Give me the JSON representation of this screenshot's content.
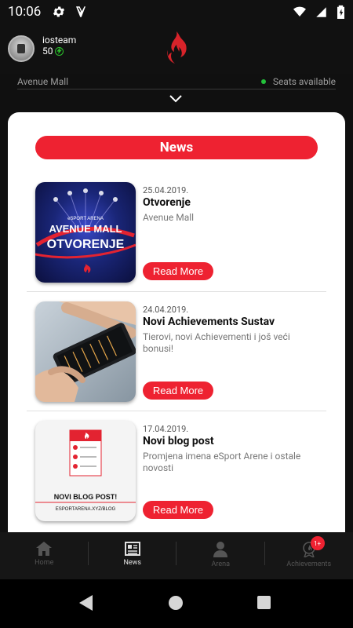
{
  "status": {
    "time": "10:06"
  },
  "user": {
    "name": "iosteam",
    "points": "50"
  },
  "location": {
    "name": "Avenue Mall",
    "seats_text": "Seats available"
  },
  "section_title": "News",
  "news": [
    {
      "date": "25.04.2019.",
      "title": "Otvorenje",
      "desc": "Avenue Mall",
      "button": "Read More",
      "thumb": {
        "top_text": "AVENUE MALL",
        "main_text": "OTVORENJE",
        "small_text": "eSPORT ARENA"
      }
    },
    {
      "date": "24.04.2019.",
      "title": "Novi Achievements Sustav",
      "desc": "Tierovi, novi Achievementi i još veći bonusi!",
      "button": "Read More"
    },
    {
      "date": "17.04.2019.",
      "title": "Novi blog post",
      "desc": "Promjena imena eSport Arene i ostale novosti",
      "button": "Read More",
      "thumb": {
        "line1": "NOVI BLOG POST!",
        "line2": "ESPORTARENA.XYZ/BLOG"
      }
    }
  ],
  "nav": [
    {
      "label": "Home",
      "icon": "home-icon"
    },
    {
      "label": "News",
      "icon": "news-icon"
    },
    {
      "label": "Arena",
      "icon": "person-icon"
    },
    {
      "label": "Achievements",
      "icon": "achievements-icon",
      "badge": "1+"
    }
  ],
  "colors": {
    "accent": "#ee2231",
    "background": "#111111",
    "panel": "#ffffff"
  }
}
